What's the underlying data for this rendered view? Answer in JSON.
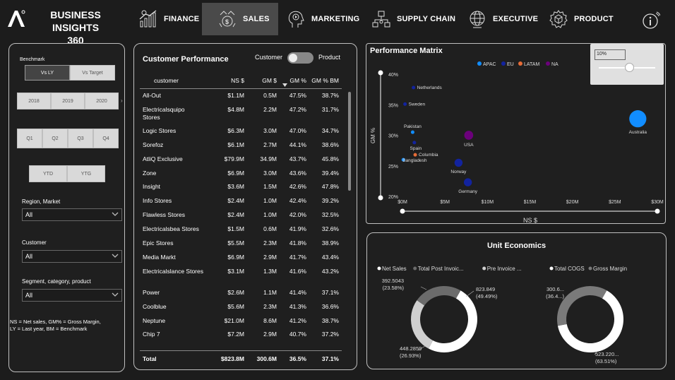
{
  "header": {
    "brand_line1": "BUSINESS INSIGHTS",
    "brand_line2": "360",
    "nav": [
      {
        "label": "FINANCE",
        "icon": "finance-chart-icon"
      },
      {
        "label": "SALES",
        "icon": "sales-money-icon",
        "active": true
      },
      {
        "label": "MARKETING",
        "icon": "marketing-head-icon"
      },
      {
        "label": "SUPPLY CHAIN",
        "icon": "supply-chain-icon"
      },
      {
        "label": "EXECUTIVE",
        "icon": "executive-globe-icon"
      },
      {
        "label": "PRODUCT",
        "icon": "product-box-icon"
      }
    ],
    "info_icon": "info-icon"
  },
  "slicers": {
    "benchmark_label": "Benchmark",
    "benchmark_options": [
      "Vs LY",
      "Vs Target"
    ],
    "benchmark_selected": "Vs LY",
    "years": [
      "2018",
      "2019",
      "2020"
    ],
    "quarters": [
      "Q1",
      "Q2",
      "Q3",
      "Q4"
    ],
    "ytd": "YTD",
    "ytg": "YTG",
    "region_label": "Region, Market",
    "region_value": "All",
    "customer_label": "Customer",
    "customer_value": "All",
    "segment_label": "Segment, category, product",
    "segment_value": "All",
    "note_line1": "NS = Net sales, GM% = Gross Margin,",
    "note_line2": "LY = Last year, BM = Benchmark"
  },
  "customer_table": {
    "title": "Customer Performance",
    "toggle_left": "Customer",
    "toggle_right": "Product",
    "columns": [
      "customer",
      "NS $",
      "GM $",
      "GM %",
      "GM % BM"
    ],
    "rows": [
      [
        "All-Out",
        "$1.1M",
        "0.5M",
        "47.5%",
        "38.7%"
      ],
      [
        "Electricalsquipo Stores",
        "$4.8M",
        "2.2M",
        "47.2%",
        "31.7%"
      ],
      [
        "Logic Stores",
        "$6.3M",
        "3.0M",
        "47.0%",
        "34.7%"
      ],
      [
        "Sorefoz",
        "$6.1M",
        "2.7M",
        "44.1%",
        "38.6%"
      ],
      [
        "AtliQ Exclusive",
        "$79.9M",
        "34.9M",
        "43.7%",
        "45.8%"
      ],
      [
        "Zone",
        "$6.9M",
        "3.0M",
        "43.6%",
        "39.4%"
      ],
      [
        "Insight",
        "$3.6M",
        "1.5M",
        "42.6%",
        "47.8%"
      ],
      [
        "Info Stores",
        "$2.4M",
        "1.0M",
        "42.4%",
        "39.2%"
      ],
      [
        "Flawless Stores",
        "$2.4M",
        "1.0M",
        "42.0%",
        "32.5%"
      ],
      [
        "Electricalsbea Stores",
        "$1.5M",
        "0.6M",
        "41.9%",
        "32.6%"
      ],
      [
        "Epic Stores",
        "$5.5M",
        "2.3M",
        "41.8%",
        "38.9%"
      ],
      [
        "Media Markt",
        "$6.9M",
        "2.9M",
        "41.7%",
        "43.4%"
      ],
      [
        "Electricalslance Stores",
        "$3.1M",
        "1.3M",
        "41.6%",
        "43.2%"
      ],
      [
        "Power",
        "$2.6M",
        "1.1M",
        "41.4%",
        "37.1%"
      ],
      [
        "Coolblue",
        "$5.6M",
        "2.3M",
        "41.3%",
        "36.6%"
      ],
      [
        "Neptune",
        "$21.0M",
        "8.6M",
        "41.2%",
        "38.7%"
      ],
      [
        "Chip 7",
        "$7.2M",
        "2.9M",
        "40.7%",
        "37.2%"
      ]
    ],
    "total": [
      "Total",
      "$823.8M",
      "300.6M",
      "36.5%",
      "37.1%"
    ]
  },
  "chart_data": [
    {
      "type": "scatter",
      "title": "Performance Matrix",
      "xlabel": "NS $",
      "ylabel": "GM %",
      "x_ticks": [
        "$0M",
        "$5M",
        "$10M",
        "$15M",
        "$20M",
        "$25M",
        "$30M"
      ],
      "y_ticks": [
        "20%",
        "25%",
        "30%",
        "35%",
        "40%"
      ],
      "xlim": [
        0,
        30
      ],
      "ylim": [
        20,
        40
      ],
      "zoom_value": "10%",
      "legend": [
        {
          "name": "APAC",
          "color": "#118dff"
        },
        {
          "name": "EU",
          "color": "#12239e"
        },
        {
          "name": "LATAM",
          "color": "#e66c37"
        },
        {
          "name": "NA",
          "color": "#6b007b"
        }
      ],
      "points": [
        {
          "label": "Netherlands",
          "x": 1.3,
          "y": 37.8,
          "region": "EU",
          "size": 1
        },
        {
          "label": "Sweden",
          "x": 0.3,
          "y": 35.1,
          "region": "EU",
          "size": 1
        },
        {
          "label": "Pakistan",
          "x": 1.2,
          "y": 30.5,
          "region": "APAC",
          "size": 1
        },
        {
          "label": "Spain",
          "x": 1.4,
          "y": 28.8,
          "region": "EU",
          "size": 1
        },
        {
          "label": "Columbia",
          "x": 1.5,
          "y": 26.8,
          "region": "LATAM",
          "size": 1
        },
        {
          "label": "Bangladesh",
          "x": 0.1,
          "y": 26.0,
          "region": "APAC",
          "size": 1
        },
        {
          "label": "USA",
          "x": 7.8,
          "y": 30.0,
          "region": "NA",
          "size": 2.2
        },
        {
          "label": "Norway",
          "x": 6.6,
          "y": 25.5,
          "region": "EU",
          "size": 2
        },
        {
          "label": "Germany",
          "x": 7.7,
          "y": 22.3,
          "region": "EU",
          "size": 2
        },
        {
          "label": "Australia",
          "x": 27.7,
          "y": 32.7,
          "region": "APAC",
          "size": 4
        }
      ]
    },
    {
      "type": "pie",
      "title": "Unit Economics",
      "legend": [
        "Net Sales",
        "Total Post Invoic...",
        "Pre Invoice ..."
      ],
      "slices": [
        {
          "name": "Net Sales",
          "value": 823.849,
          "label": "823.849",
          "pct": "(49.49%)",
          "color": "#ffffff"
        },
        {
          "name": "Pre Invoice ...",
          "value": 448.2859,
          "label": "448.2859",
          "pct": "(26.93%)",
          "color": "#cfcfcf"
        },
        {
          "name": "Total Post Invoic...",
          "value": 392.5043,
          "label": "392.5043",
          "pct": "(23.58%)",
          "color": "#6b6b6b"
        }
      ]
    },
    {
      "type": "pie",
      "legend": [
        "Total COGS",
        "Gross Margin"
      ],
      "slices": [
        {
          "name": "Total COGS",
          "value": 523.22,
          "label": "523.220...",
          "pct": "(63.51%)",
          "color": "#ffffff"
        },
        {
          "name": "Gross Margin",
          "value": 300.6,
          "label": "300.6...",
          "pct": "(36.4...)",
          "color": "#7a7a7a"
        }
      ]
    }
  ]
}
